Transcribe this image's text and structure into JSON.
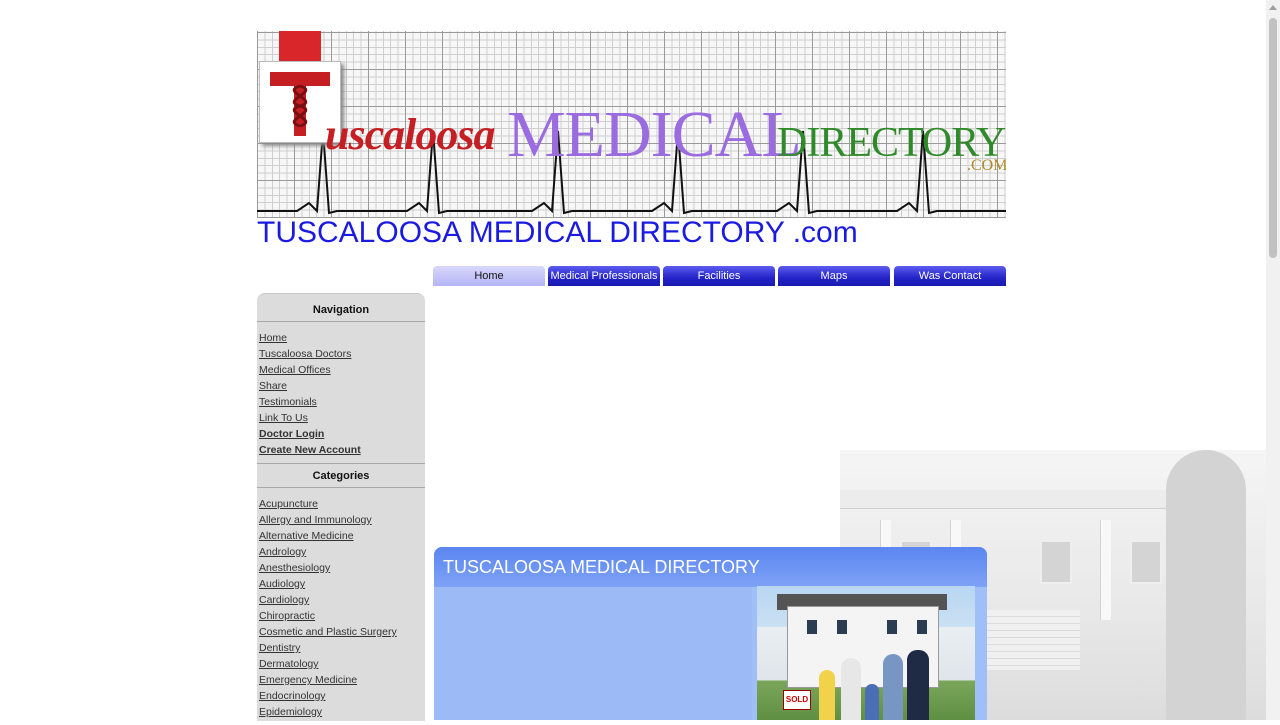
{
  "banner": {
    "logo_t": "T",
    "logo_word1": "uscaloosa",
    "logo_word2": "MEDICAL",
    "logo_word3": "DIRECTORY",
    "logo_com": ".COM"
  },
  "site_title": "TUSCALOOSA MEDICAL DIRECTORY .com",
  "tabs": [
    {
      "label": "Home",
      "active": true
    },
    {
      "label": "Medical Professionals",
      "active": false
    },
    {
      "label": "Facilities",
      "active": false
    },
    {
      "label": "Maps",
      "active": false
    },
    {
      "label": "Was Contact",
      "active": false
    }
  ],
  "sidebar": {
    "navigation_heading": "Navigation",
    "nav_items": [
      {
        "label": "Home"
      },
      {
        "label": "Tuscaloosa Doctors"
      },
      {
        "label": "Medical Offices"
      },
      {
        "label": "Share"
      },
      {
        "label": "Testimonials"
      },
      {
        "label": "Link To Us"
      },
      {
        "label": "Doctor Login",
        "bold": true
      },
      {
        "label": "Create New Account",
        "bold": true
      }
    ],
    "categories_heading": "Categories",
    "categories": [
      "Acupuncture",
      "Allergy and Immunology",
      "Alternative Medicine",
      "Andrology",
      "Anesthesiology",
      "Audiology",
      "Cardiology",
      "Chiropractic",
      "Cosmetic and Plastic Surgery",
      "Dentistry",
      "Dermatology",
      "Emergency Medicine",
      "Endocrinology",
      "Epidemiology"
    ]
  },
  "content": {
    "heading": "TUSCALOOSA MEDICAL DIRECTORY",
    "photo_sign": "SOLD"
  },
  "colors": {
    "title_blue": "#1a1ae0",
    "tab_blue": "#2323c8",
    "tab_active": "#b4b4f4",
    "sidebar_gray": "#dcdcdc",
    "content_blue": "#a0bff8",
    "logo_red": "#c51f24",
    "logo_purple": "#9b6be0",
    "logo_green": "#2f8a2a"
  }
}
